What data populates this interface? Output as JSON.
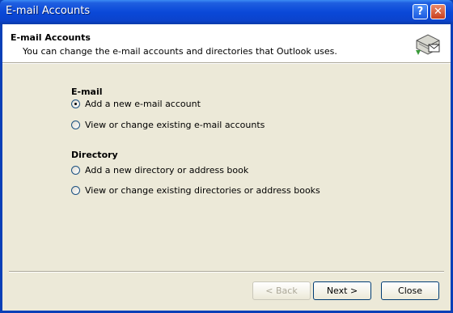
{
  "window": {
    "title": "E-mail Accounts",
    "help_button": "?",
    "close_button": "✕"
  },
  "header": {
    "title": "E-mail Accounts",
    "subtitle": "You can change the e-mail accounts and directories that Outlook uses.",
    "icon": "mail-accounts-icon"
  },
  "email_section": {
    "heading": "E-mail",
    "options": [
      {
        "label": "Add a new e-mail account",
        "checked": true
      },
      {
        "label": "View or change existing e-mail accounts",
        "checked": false
      }
    ]
  },
  "directory_section": {
    "heading": "Directory",
    "options": [
      {
        "label": "Add a new directory or address book",
        "checked": false
      },
      {
        "label": "View or change existing directories or address books",
        "checked": false
      }
    ]
  },
  "buttons": {
    "back": "< Back",
    "next": "Next >",
    "close": "Close"
  },
  "colors": {
    "titlebar": "#0a48d8",
    "dialog": "#ece9d8",
    "accent_border": "#003c74"
  }
}
